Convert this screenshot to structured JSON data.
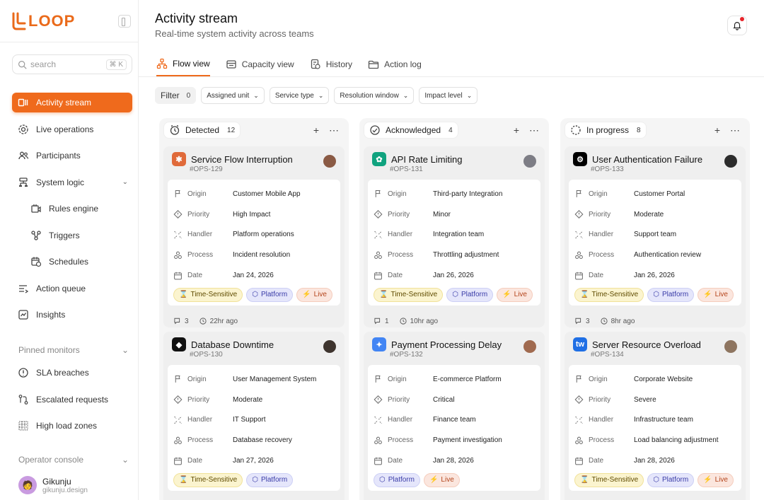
{
  "app": {
    "logo": "LOOP",
    "search_placeholder": "search",
    "search_shortcut": "⌘ K"
  },
  "nav": [
    {
      "label": "Activity stream",
      "icon": "stream-icon",
      "active": true
    },
    {
      "label": "Live operations",
      "icon": "gear-icon"
    },
    {
      "label": "Participants",
      "icon": "users-icon"
    },
    {
      "label": "System logic",
      "icon": "hierarchy-icon",
      "expand": true
    },
    {
      "label": "Rules engine",
      "icon": "rules-icon",
      "sub": true
    },
    {
      "label": "Triggers",
      "icon": "trigger-icon",
      "sub": true
    },
    {
      "label": "Schedules",
      "icon": "calendar-clock-icon",
      "sub": true
    },
    {
      "label": "Action queue",
      "icon": "queue-icon"
    },
    {
      "label": "Insights",
      "icon": "chart-icon"
    }
  ],
  "pinned": {
    "label": "Pinned monitors",
    "items": [
      {
        "label": "SLA breaches",
        "icon": "alert-icon"
      },
      {
        "label": "Escalated requests",
        "icon": "escalate-icon"
      },
      {
        "label": "High load zones",
        "icon": "grid-icon"
      }
    ]
  },
  "console": {
    "label": "Operator console"
  },
  "user": {
    "name": "Gikunju",
    "handle": "gikunju.design"
  },
  "header": {
    "title": "Activity stream",
    "subtitle": "Real-time system activity across teams"
  },
  "tabs": [
    {
      "label": "Flow view",
      "active": true
    },
    {
      "label": "Capacity view"
    },
    {
      "label": "History"
    },
    {
      "label": "Action log"
    }
  ],
  "filters": {
    "label": "Filter",
    "count": "0",
    "items": [
      "Assigned unit",
      "Service type",
      "Resolution window",
      "Impact level"
    ]
  },
  "field_labels": {
    "origin": "Origin",
    "priority": "Priority",
    "handler": "Handler",
    "process": "Process",
    "date": "Date"
  },
  "tag_labels": {
    "ts": "Time-Sensitive",
    "pf": "Platform",
    "lv": "Live"
  },
  "columns": [
    {
      "name": "Detected",
      "count": "12",
      "cards": [
        {
          "title": "Service Flow Interruption",
          "id": "#OPS-129",
          "logo_color": "#e06a3a",
          "logo_glyph": "✱",
          "origin": "Customer Mobile App",
          "priority": "High Impact",
          "handler": "Platform operations",
          "process": "Incident resolution",
          "date": "Jan 24, 2026",
          "tags": [
            "ts",
            "pf",
            "lv"
          ],
          "comments": "3",
          "time": "22hr ago"
        },
        {
          "title": "Database Downtime",
          "id": "#OPS-130",
          "logo_color": "#111111",
          "logo_glyph": "◆",
          "origin": "User Management System",
          "priority": "Moderate",
          "handler": "IT Support",
          "process": "Database recovery",
          "date": "Jan 27, 2026",
          "tags": [
            "ts",
            "pf"
          ]
        }
      ]
    },
    {
      "name": "Acknowledged",
      "count": "4",
      "cards": [
        {
          "title": "API Rate Limiting",
          "id": "#OPS-131",
          "logo_color": "#10a37f",
          "logo_glyph": "✿",
          "origin": "Third-party Integration",
          "priority": "Minor",
          "handler": "Integration team",
          "process": "Throttling adjustment",
          "date": "Jan 26, 2026",
          "tags": [
            "ts",
            "pf",
            "lv"
          ],
          "comments": "1",
          "time": "10hr ago"
        },
        {
          "title": "Payment Processing Delay",
          "id": "#OPS-132",
          "logo_color": "#4285f4",
          "logo_glyph": "✦",
          "origin": "E-commerce Platform",
          "priority": "Critical",
          "handler": "Finance team",
          "process": "Payment investigation",
          "date": "Jan 28, 2026",
          "tags": [
            "pf",
            "lv"
          ]
        }
      ]
    },
    {
      "name": "In progress",
      "count": "8",
      "cards": [
        {
          "title": "User Authentication Failure",
          "id": "#OPS-133",
          "logo_color": "#000000",
          "logo_glyph": "⚙",
          "origin": "Customer Portal",
          "priority": "Moderate",
          "handler": "Support team",
          "process": "Authentication review",
          "date": "Jan 26, 2026",
          "tags": [
            "ts",
            "pf",
            "lv"
          ],
          "comments": "3",
          "time": "8hr ago"
        },
        {
          "title": "Server Resource Overload",
          "id": "#OPS-134",
          "logo_color": "#1f6fe5",
          "logo_glyph": "tw",
          "origin": "Corporate Website",
          "priority": "Severe",
          "handler": "Infrastructure team",
          "process": "Load balancing adjustment",
          "date": "Jan 28, 2026",
          "tags": [
            "ts",
            "pf",
            "lv"
          ]
        }
      ]
    }
  ],
  "colors": {
    "accent": "#ef6a1c"
  }
}
